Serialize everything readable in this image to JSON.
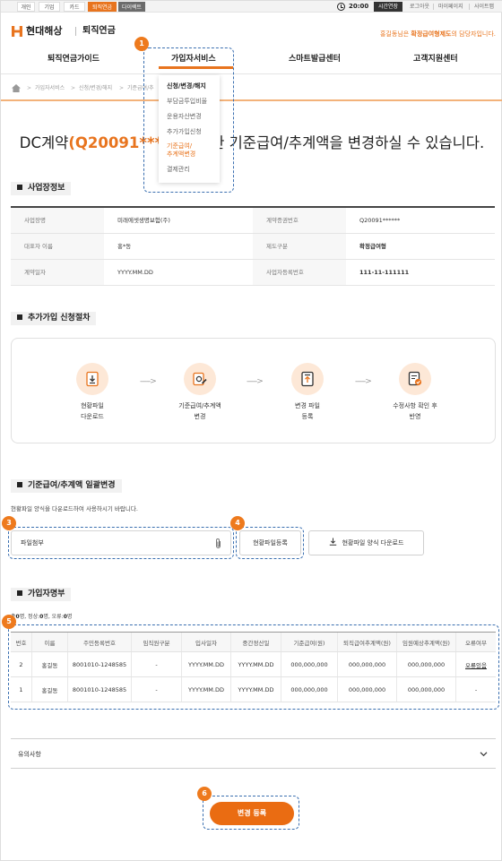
{
  "topbar": {
    "tabs": [
      "개인",
      "기업",
      "카드",
      "퇴직연금",
      "다이렉트"
    ],
    "active_tab": "퇴직연금",
    "time": "20:00",
    "extend_label": "시간연장",
    "links": [
      "로그아웃",
      "마이페이지",
      "사이트맵"
    ]
  },
  "header": {
    "logo_text": "현대해상",
    "logo_sub": "퇴직연금",
    "greeting_pre": "홍길동님은",
    "greeting_bold": "확정급여형제도",
    "greeting_post": "의 담당자입니다."
  },
  "gnb": [
    "퇴직연금가이드",
    "가입자서비스",
    "스마트발급센터",
    "고객지원센터"
  ],
  "dropdown": {
    "items": [
      "신청/변경/해지",
      "부담금투입비율",
      "운용자산변경",
      "추가가입신청",
      "기준급여/",
      "추계액변경",
      "결제관리"
    ]
  },
  "breadcrumb": [
    "가입자서비스",
    "신청/변경/해지",
    "기준급여/추"
  ],
  "heading": {
    "pre": "DC계약",
    "contract": "(Q20091***",
    "post": "한 기준급여/추계액을 변경하실 수 있습니다."
  },
  "business": {
    "title": "사업장정보",
    "rows": [
      [
        "사업장명",
        "미래에셋생명보험(주)",
        "계약증권번호",
        "Q20091******"
      ],
      [
        "대표자 이름",
        "홍*동",
        "제도구분",
        "확정급여형"
      ],
      [
        "계약일자",
        "YYYY.MM.DD",
        "사업자등록번호",
        "111-11-111111"
      ]
    ]
  },
  "process": {
    "title": "추가가입 신청절차",
    "steps": [
      {
        "line1": "현황파일",
        "line2": "다운로드"
      },
      {
        "line1": "기준급여/추계액",
        "line2": "변경"
      },
      {
        "line1": "변경 파일",
        "line2": "등록"
      },
      {
        "line1": "수정사항 확인 후",
        "line2": "반영"
      }
    ]
  },
  "bulk": {
    "title": "기준급여/추계액 일괄변경",
    "desc": "현황파일 양식을 다운로드하여 사용하시기 바랍니다.",
    "file_label": "파일첨부",
    "register_button": "현황파일등록",
    "download_button": "현황파일 양식 다운로드"
  },
  "members": {
    "title": "가입자명부",
    "counts": {
      "total_label": "총",
      "total": "0",
      "unit1": "명, 정상:",
      "normal": "0",
      "unit2": "명, 오류:",
      "error": "0",
      "unit3": "명"
    },
    "headers": [
      "번호",
      "이름",
      "주민등록번호",
      "임직원구분",
      "입사일자",
      "중간정산일",
      "기준급여(원)",
      "퇴직급여추계액(원)",
      "임원예상추계액(원)",
      "오류여부"
    ],
    "rows": [
      [
        "2",
        "홍길동",
        "8001010-1248585",
        "-",
        "YYYY.MM.DD",
        "YYYY.MM.DD",
        "000,000,000",
        "000,000,000",
        "000,000,000",
        "오류있음"
      ],
      [
        "1",
        "홍길동",
        "8001010-1248585",
        "-",
        "YYYY.MM.DD",
        "YYYY.MM.DD",
        "000,000,000",
        "000,000,000",
        "000,000,000",
        "-"
      ]
    ]
  },
  "notes": {
    "label": "유의사항"
  },
  "submit": {
    "label": "변경 등록"
  },
  "badges": [
    "1",
    "3",
    "4",
    "5",
    "6"
  ],
  "colors": {
    "accent": "#e8741e",
    "annotation": "#3a6fb0",
    "badge": "#ee7a1d"
  }
}
